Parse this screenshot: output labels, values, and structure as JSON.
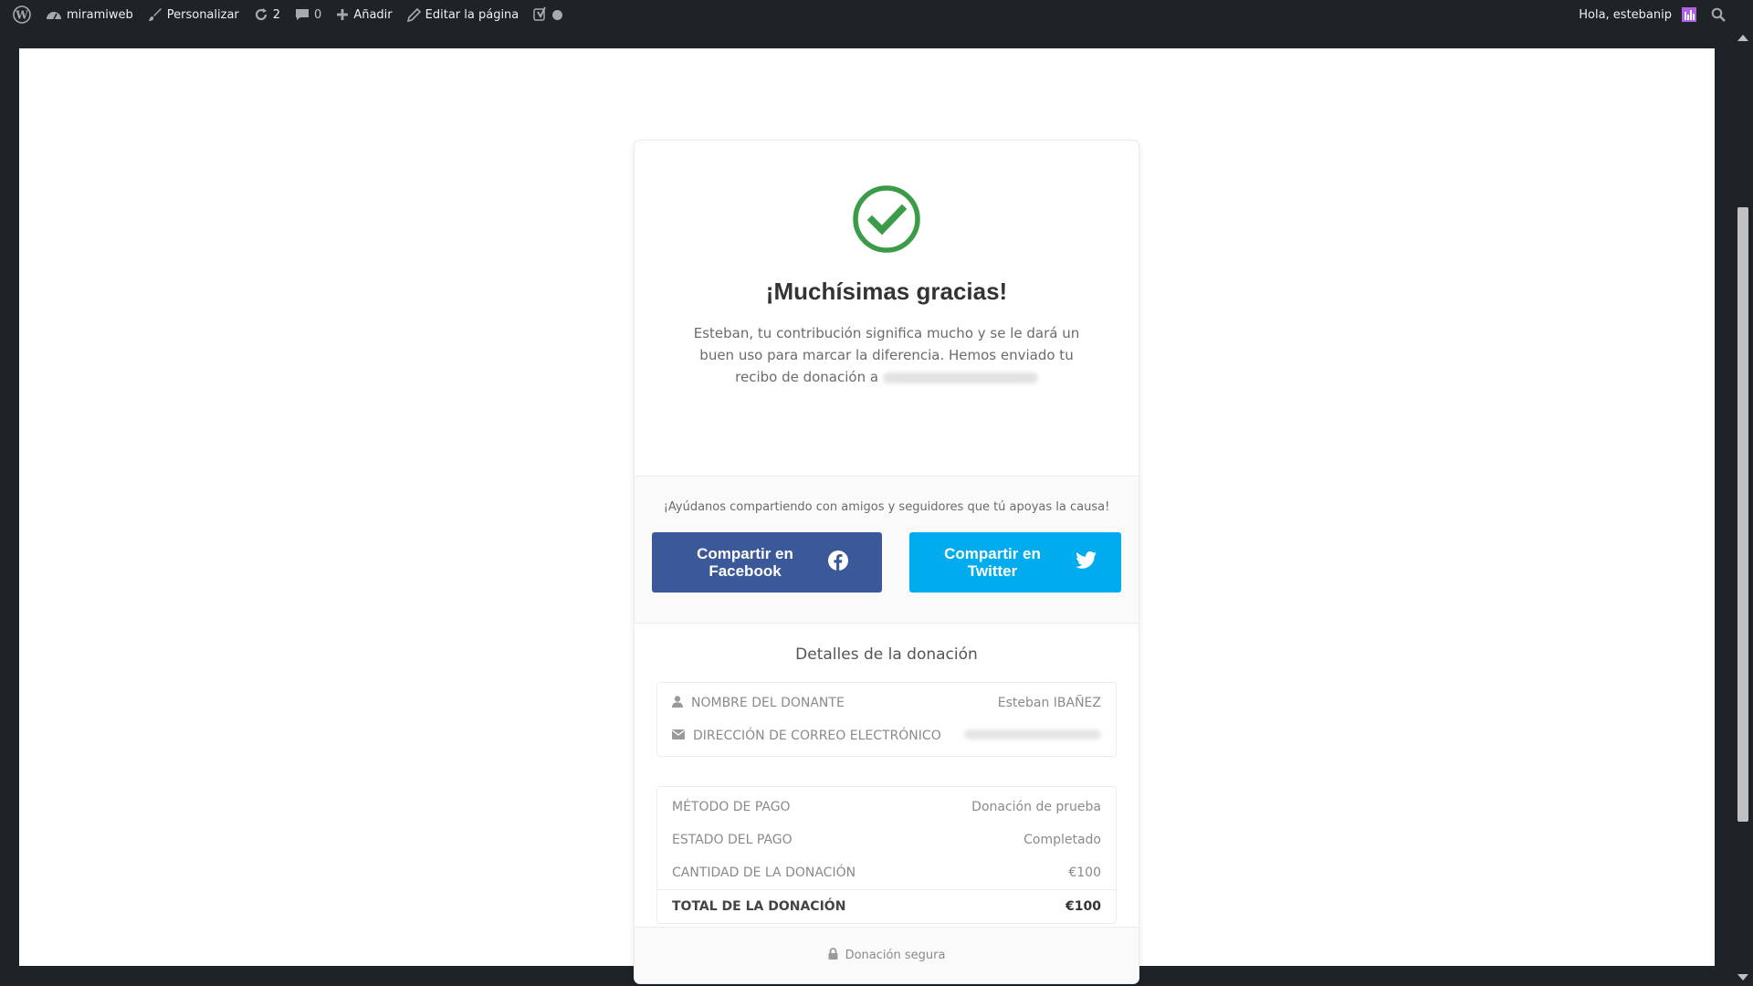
{
  "adminbar": {
    "site_name": "miramiweb",
    "customize": "Personalizar",
    "updates_count": "2",
    "comments_count": "0",
    "add_new": "Añadir",
    "edit_page": "Editar la página",
    "greeting": "Hola, estebanip"
  },
  "receipt": {
    "title": "¡Muchísimas gracias!",
    "message": "Esteban, tu contribución significa mucho y se le dará un buen uso para marcar la diferencia. Hemos enviado tu recibo de donación a",
    "share_hint": "¡Ayúdanos compartiendo con amigos y seguidores que tú apoyas la causa!",
    "share_facebook": "Compartir en Facebook",
    "share_twitter": "Compartir en Twitter",
    "details_title": "Detalles de la donación",
    "donor_label": "NOMBRE DEL DONANTE",
    "donor_value": "Esteban IBAÑEZ",
    "email_label": "DIRECCIÓN DE CORREO ELECTRÓNICO",
    "payment_method_label": "MÉTODO DE PAGO",
    "payment_method_value": "Donación de prueba",
    "payment_status_label": "ESTADO DEL PAGO",
    "payment_status_value": "Completado",
    "amount_label": "CANTIDAD DE LA DONACIÓN",
    "amount_value": "€100",
    "total_label": "TOTAL DE LA DONACIÓN",
    "total_value": "€100",
    "secure_label": "Donación segura"
  },
  "colors": {
    "success_green": "#3a9b48",
    "facebook_blue": "#3b5998",
    "twitter_blue": "#00aced",
    "adminbar_bg": "#1d2327"
  }
}
